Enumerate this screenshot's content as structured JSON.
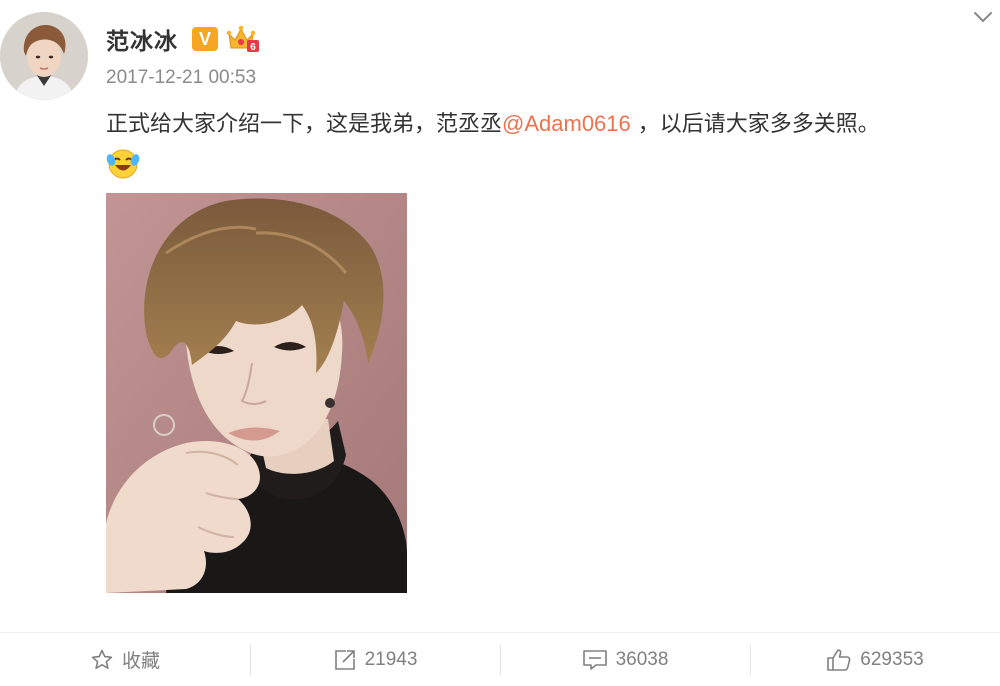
{
  "post": {
    "author": {
      "name": "范冰冰",
      "verified_label": "V"
    },
    "timestamp": "2017-12-21 00:53",
    "text_before": "正式给大家介绍一下，这是我弟，范丞丞",
    "mention": "@Adam0616",
    "text_after": " ，以后请大家多多关照。",
    "emoji": "laughing-crying-emoji"
  },
  "actions": {
    "favorite_label": "收藏",
    "repost_count": "21943",
    "comment_count": "36038",
    "like_count": "629353"
  },
  "colors": {
    "mention": "#eb7350",
    "verified_badge": "#f6a623",
    "muted_text": "#808080",
    "photo_background": "#b98a8a"
  }
}
